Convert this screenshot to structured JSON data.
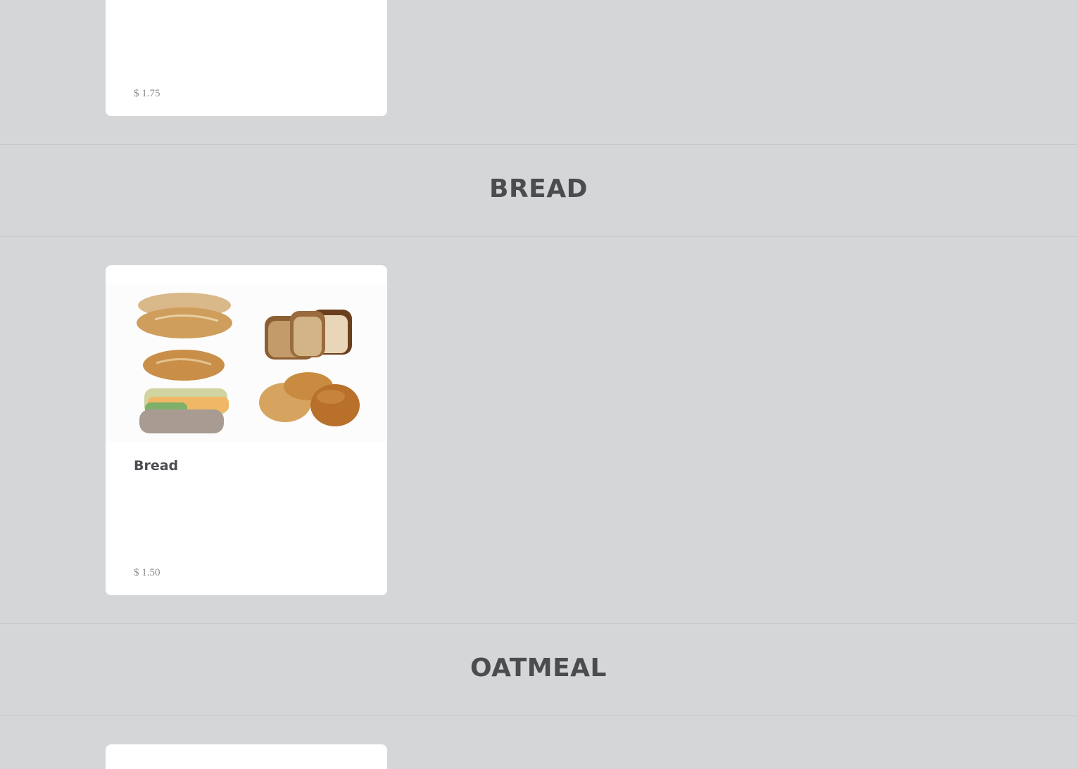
{
  "previous_item": {
    "price": "$ 1.75"
  },
  "sections": {
    "bread": {
      "heading": "BREAD",
      "item": {
        "name": "Bread",
        "price": "$ 1.50",
        "image_icon": "bread-assortment-image"
      }
    },
    "oatmeal": {
      "heading": "OATMEAL"
    }
  },
  "colors": {
    "background": "#d5d6d8",
    "card": "#ffffff",
    "heading_text": "#4a4c50",
    "price_text": "#8a8a8a"
  }
}
